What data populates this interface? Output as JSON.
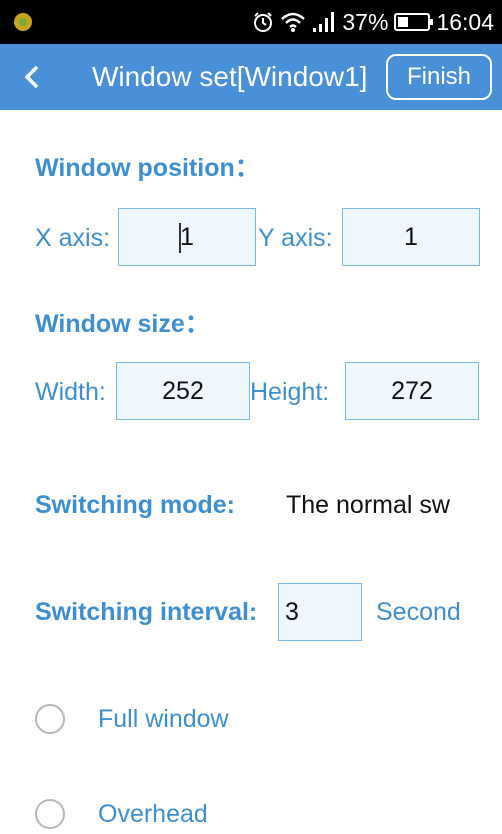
{
  "status_bar": {
    "battery_percent": "37%",
    "battery_level": 0.37,
    "time": "16:04",
    "icons": [
      "app-icon",
      "alarm-icon",
      "wifi-icon",
      "signal-icon",
      "battery-icon"
    ]
  },
  "header": {
    "back_icon": "chevron-left-icon",
    "title": "Window set[Window1]",
    "finish_label": "Finish",
    "background": "#4a90d9"
  },
  "position": {
    "section_label": "Window position：",
    "x_label": "X axis:",
    "x_value": "1",
    "y_label": "Y axis:",
    "y_value": "1"
  },
  "size": {
    "section_label": "Window size：",
    "width_label": "Width:",
    "width_value": "252",
    "height_label": "Height:",
    "height_value": "272"
  },
  "switching": {
    "mode_label": "Switching mode:",
    "mode_value": "The normal sw",
    "interval_label": "Switching interval:",
    "interval_value": "3",
    "interval_unit": "Second"
  },
  "options": [
    {
      "label": "Full window",
      "selected": false
    },
    {
      "label": "Overhead",
      "selected": false
    }
  ],
  "colors": {
    "accent": "#3d8fd1",
    "input_border": "#7ab8e8",
    "input_bg": "#eef7fd"
  }
}
